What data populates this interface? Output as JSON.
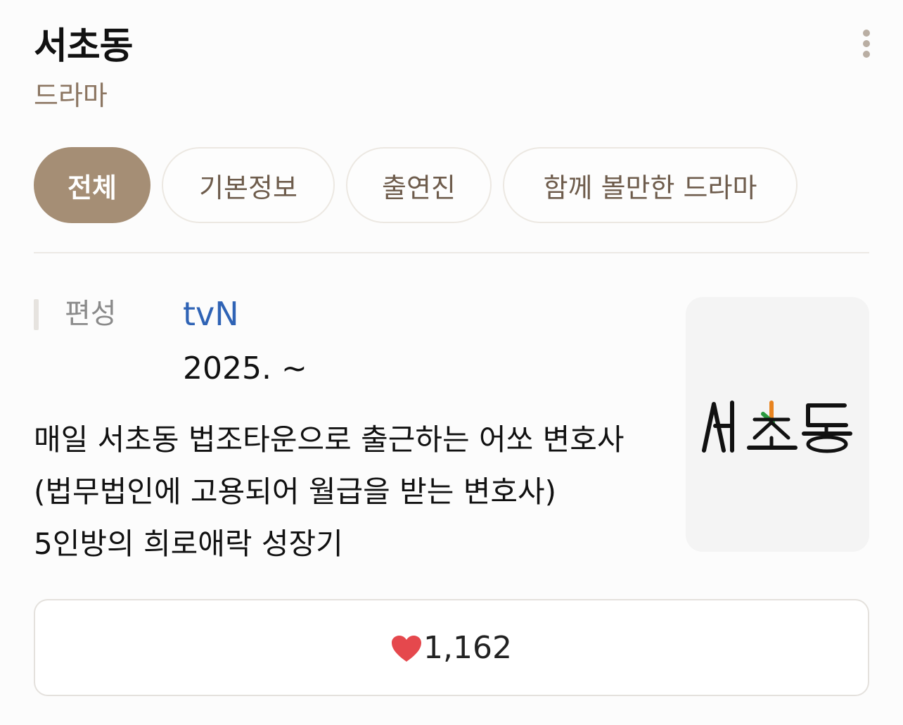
{
  "header": {
    "title": "서초동",
    "subtitle": "드라마"
  },
  "more_icon": "vertical-ellipsis-icon",
  "tabs": [
    {
      "label": "전체",
      "active": true
    },
    {
      "label": "기본정보",
      "active": false
    },
    {
      "label": "출연진",
      "active": false
    },
    {
      "label": "함께 볼만한 드라마",
      "active": false
    }
  ],
  "info": {
    "label": "편성",
    "broadcaster": "tvN",
    "air_date": "2025. ~"
  },
  "synopsis": "매일 서초동 법조타운으로 출근하는 어쏘 변호사(법무법인에 고용되어 월급을 받는 변호사) 5인방의 희로애락 성장기",
  "poster": {
    "logo_text": "서초동",
    "accent_colors": [
      "#e8831f",
      "#2a9a3f"
    ]
  },
  "like": {
    "icon": "heart-icon",
    "count": "1,162",
    "color": "#e5484d"
  },
  "colors": {
    "accent": "#a58e75",
    "link": "#2f63b5",
    "subtitle": "#8b7561"
  }
}
